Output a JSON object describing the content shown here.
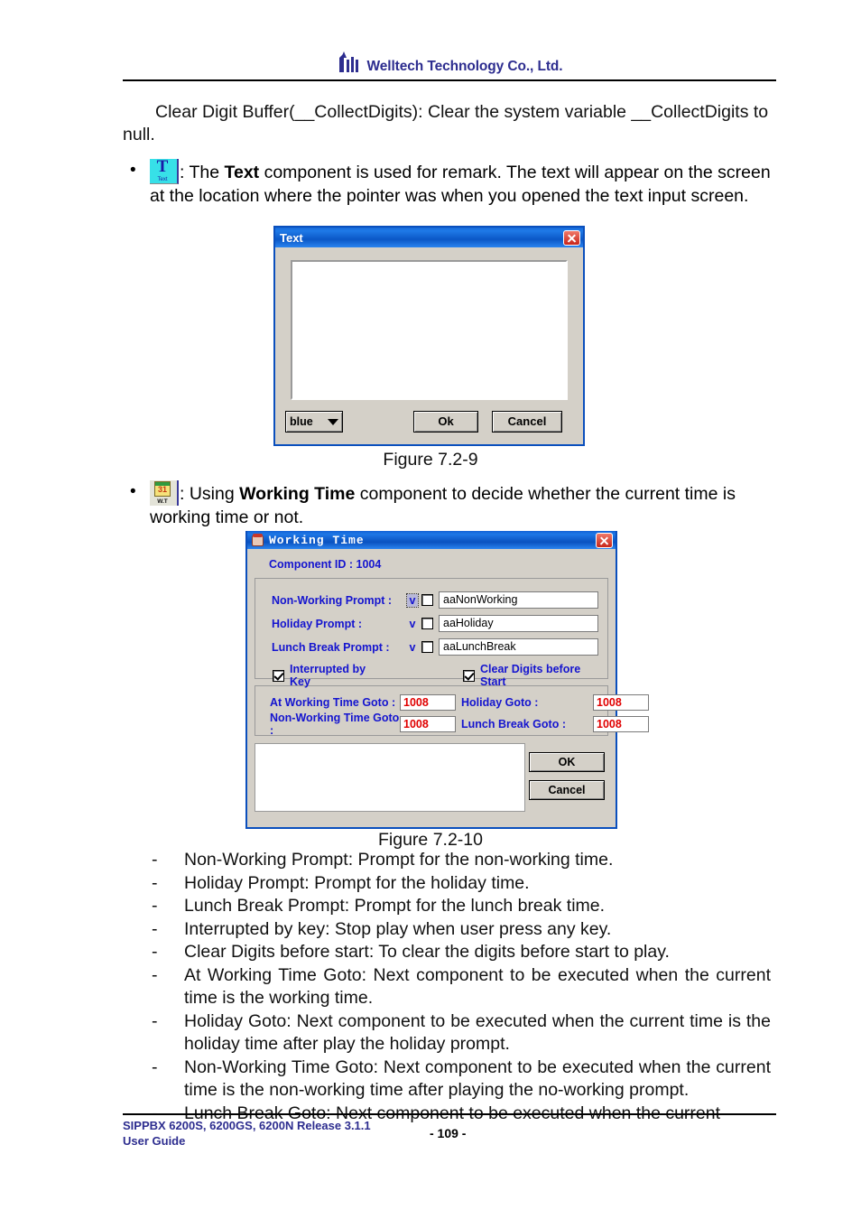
{
  "header": {
    "company": "Welltech Technology Co., Ltd.",
    "logo_icon": "welltech-logo-icon"
  },
  "intro": {
    "text": "Clear Digit Buffer(__CollectDigits): Clear the system variable __CollectDigits to null."
  },
  "bullets": [
    {
      "icon": "text-component-icon",
      "icon_glyph": "T",
      "icon_sub": "Text",
      "lead": ": The ",
      "bold": "Text",
      "rest": " component is used for remark. The text will appear on the screen at the location where the pointer was when you opened the text input screen."
    },
    {
      "icon": "working-time-component-icon",
      "icon_num": "31",
      "icon_sub": "W.T",
      "lead": ":  Using ",
      "bold": "Working Time",
      "rest": " component to decide whether the current time is working time or not."
    }
  ],
  "text_dialog": {
    "title": "Text",
    "close_icon": "close-icon",
    "textarea_value": "",
    "color_select": {
      "value": "blue",
      "options": [
        "blue"
      ]
    },
    "ok_label": "Ok",
    "cancel_label": "Cancel"
  },
  "figure_9": {
    "caption": "Figure 7.2-9"
  },
  "wt_dialog": {
    "title": "Working Time",
    "title_icon": "calendar-icon",
    "close_icon": "close-icon",
    "component_id_label": "Component ID : 1004",
    "prompt_rows": [
      {
        "label": "Non-Working Prompt :",
        "dropdown": "v",
        "checked": false,
        "value": "aaNonWorking",
        "focused": true
      },
      {
        "label": "Holiday Prompt :",
        "dropdown": "v",
        "checked": false,
        "value": "aaHoliday",
        "focused": false
      },
      {
        "label": "Lunch Break Prompt :",
        "dropdown": "v",
        "checked": false,
        "value": "aaLunchBreak",
        "focused": false
      }
    ],
    "checkboxes": [
      {
        "label": "Interrupted by Key",
        "checked": true
      },
      {
        "label": "Clear Digits before Start",
        "checked": true
      }
    ],
    "goto_rows": [
      {
        "label_left": "At Working Time Goto :",
        "value_left": "1008",
        "label_right": "Holiday Goto :",
        "value_right": "1008"
      },
      {
        "label_left": "Non-Working Time Goto :",
        "value_left": "1008",
        "label_right": "Lunch Break Goto :",
        "value_right": "1008"
      }
    ],
    "notes_value": "",
    "ok_label": "OK",
    "cancel_label": "Cancel"
  },
  "figure_10": {
    "caption": "Figure 7.2-10"
  },
  "dash_list": {
    "marker": "-",
    "items": [
      "Non-Working Prompt: Prompt for the non-working time.",
      "Holiday Prompt: Prompt for the holiday time.",
      "Lunch Break Prompt: Prompt for the lunch break time.",
      "Interrupted by key: Stop play when user press any key.",
      "Clear Digits before start: To clear the digits before start to play.",
      "At Working Time Goto: Next component to be executed when the current time is the working time.",
      "Holiday Goto: Next component to be executed when the current time is the holiday time after play the holiday prompt.",
      "Non-Working Time Goto: Next component to be executed when the current time is the non-working time after playing the no-working prompt.",
      "Lunch Break Goto: Next component to be executed when the current"
    ]
  },
  "footer": {
    "line1": "SIPPBX 6200S, 6200GS, 6200N Release 3.1.1",
    "line2": "User Guide",
    "page": "- 109 -"
  },
  "colors": {
    "brand_blue": "#2d2d8f",
    "dialog_title_blue": "#0b57c6",
    "label_blue": "#1414cf",
    "goto_red": "#e00000",
    "close_red": "#c7251a"
  }
}
